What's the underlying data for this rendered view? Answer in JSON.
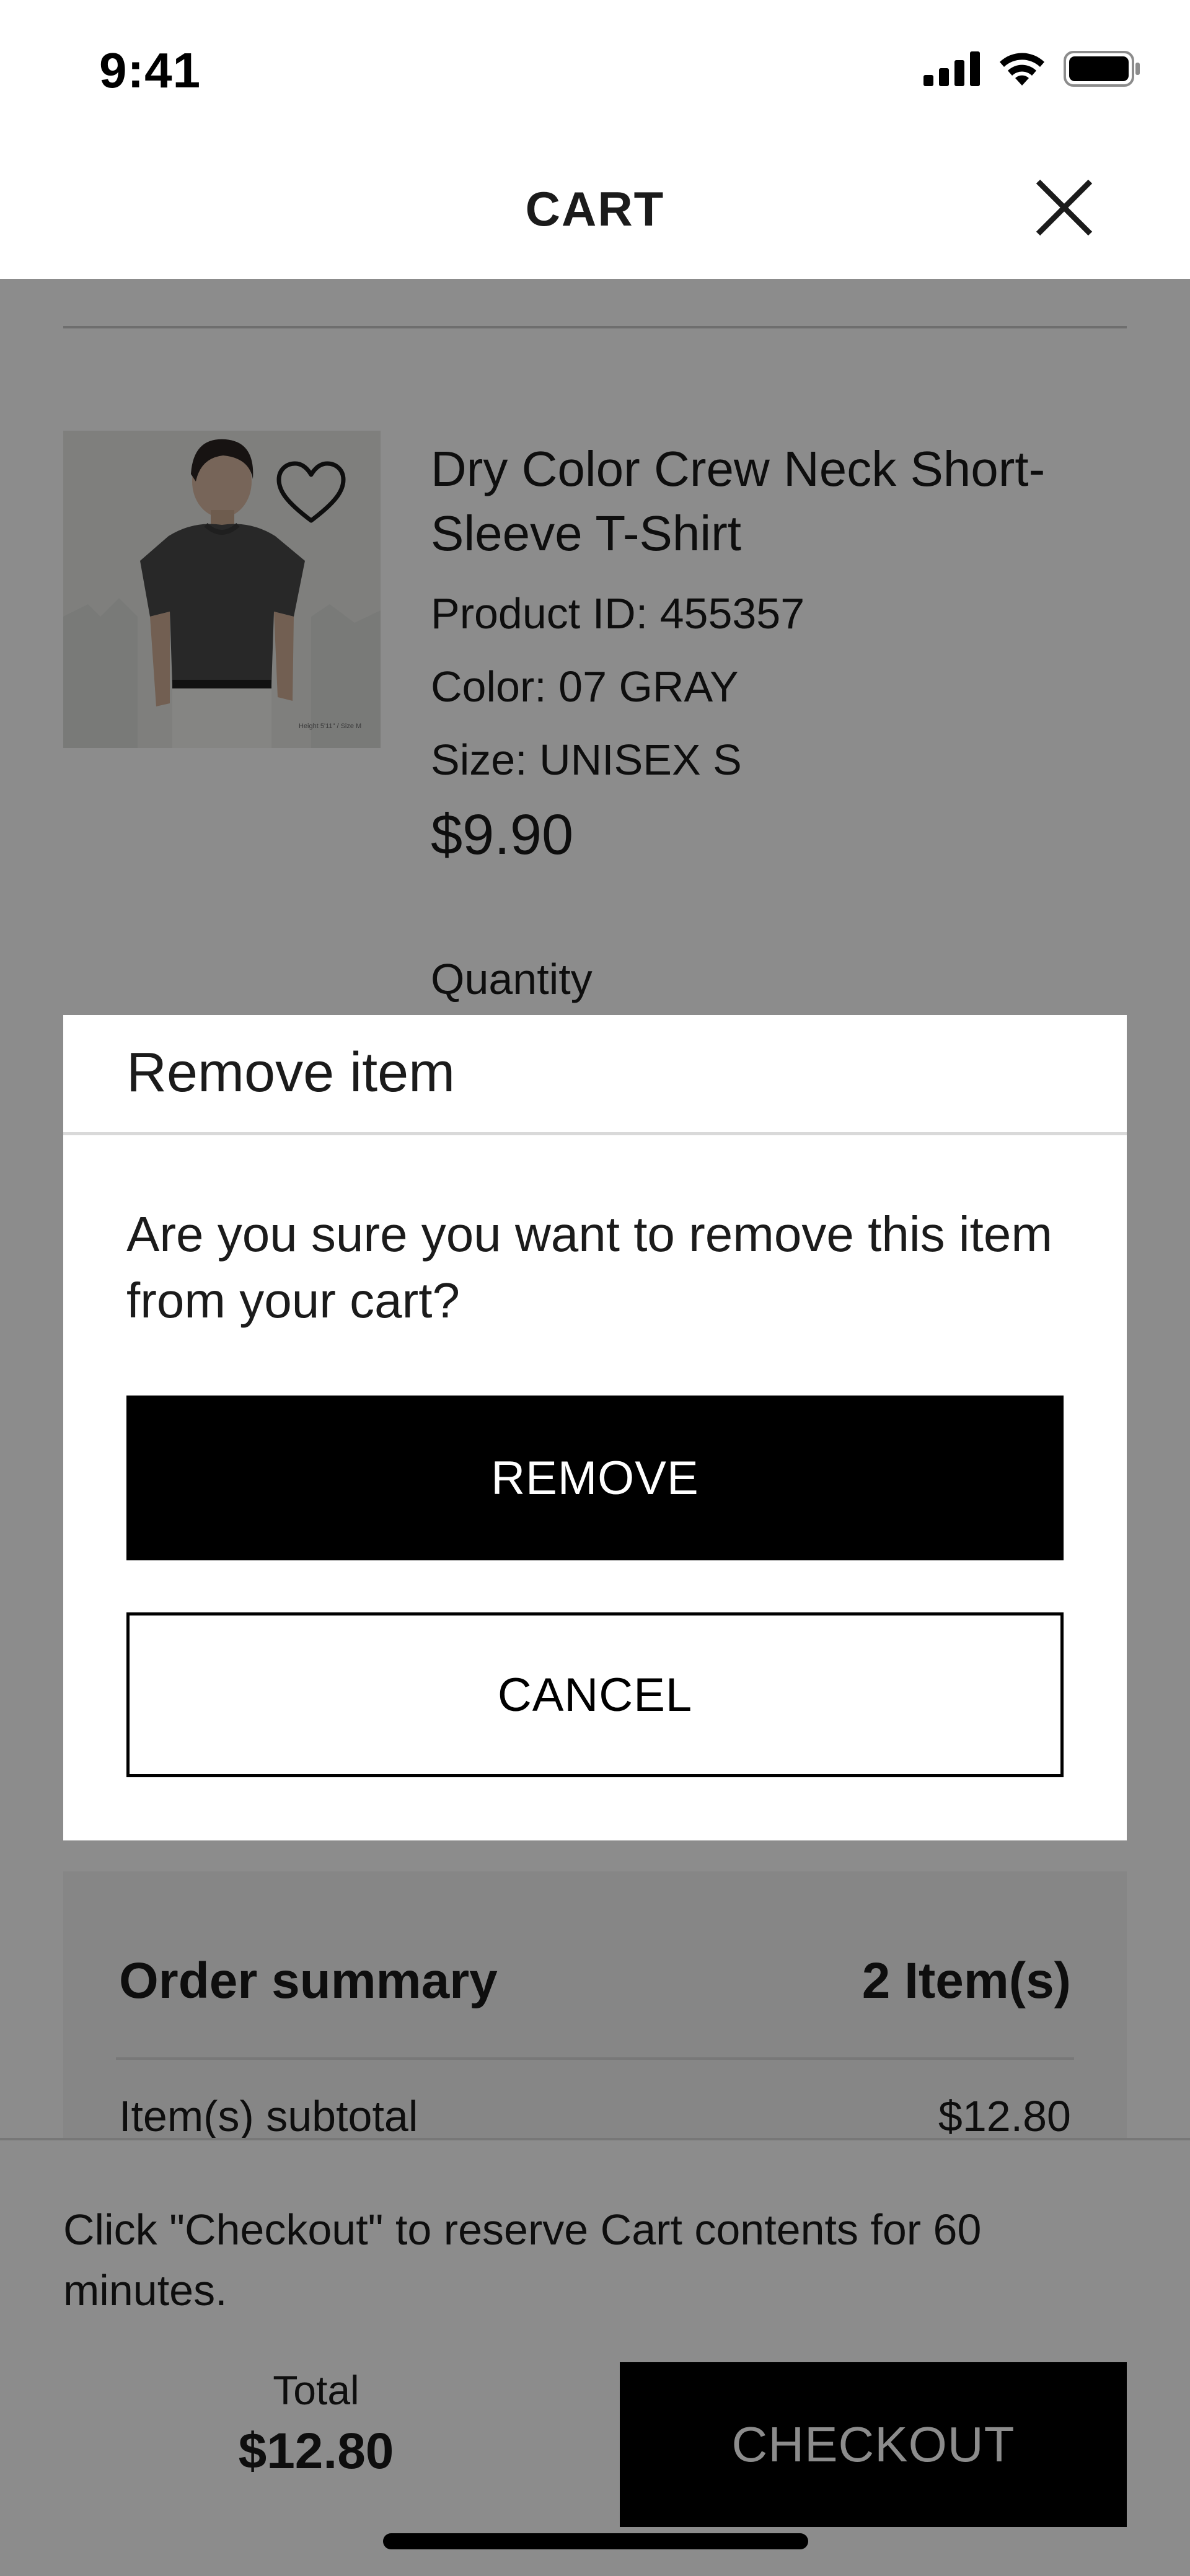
{
  "status_bar": {
    "time": "9:41",
    "icons": [
      "cellular-signal-icon",
      "wifi-icon",
      "battery-icon"
    ]
  },
  "header": {
    "title": "CART",
    "close_icon": "close-icon"
  },
  "product": {
    "name": "Dry Color Crew Neck Short-Sleeve T-Shirt",
    "product_id": "Product ID: 455357",
    "color": "Color: 07 GRAY",
    "size": "Size: UNISEX S",
    "price": "$9.90",
    "quantity_label": "Quantity",
    "image_overlay_text": "Height 5'11\" / Size M",
    "wishlist_icon": "heart-outline-icon"
  },
  "dialog": {
    "title": "Remove item",
    "message": "Are you sure you want to remove this item from your cart?",
    "remove_label": "REMOVE",
    "cancel_label": "CANCEL"
  },
  "order_summary": {
    "title": "Order summary",
    "item_count": "2 Item(s)",
    "rows": [
      {
        "label": "Item(s) subtotal",
        "value": "$12.80"
      }
    ]
  },
  "footer": {
    "note": "Click \"Checkout\" to reserve Cart contents for 60 minutes.",
    "total_label": "Total",
    "total_value": "$12.80",
    "checkout_label": "CHECKOUT"
  },
  "colors": {
    "primary_button": "#000000",
    "scrim": "rgba(0,0,0,0.45)",
    "text": "#1b1b1b",
    "summary_background": "#f4f4f4"
  }
}
